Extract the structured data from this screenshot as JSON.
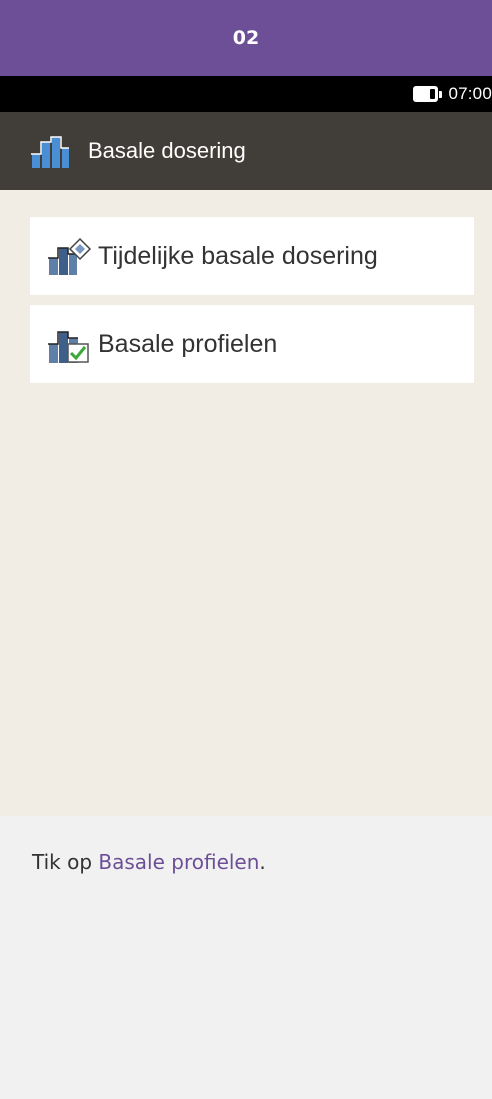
{
  "step": {
    "number": "02"
  },
  "status_bar": {
    "time": "07:00",
    "battery_icon": "battery-icon"
  },
  "title_bar": {
    "title": "Basale dosering",
    "icon": "basal-chart-icon"
  },
  "menu": {
    "items": [
      {
        "label": "Tijdelijke basale dosering",
        "icon": "temp-basal-icon"
      },
      {
        "label": "Basale profielen",
        "icon": "basal-profiles-icon"
      }
    ]
  },
  "instruction": {
    "prefix": "Tik op ",
    "highlight": "Basale profielen",
    "suffix": "."
  },
  "colors": {
    "accent": "#6c4f96",
    "title_bar": "#413d39",
    "screen_bg": "#f2ede4"
  }
}
